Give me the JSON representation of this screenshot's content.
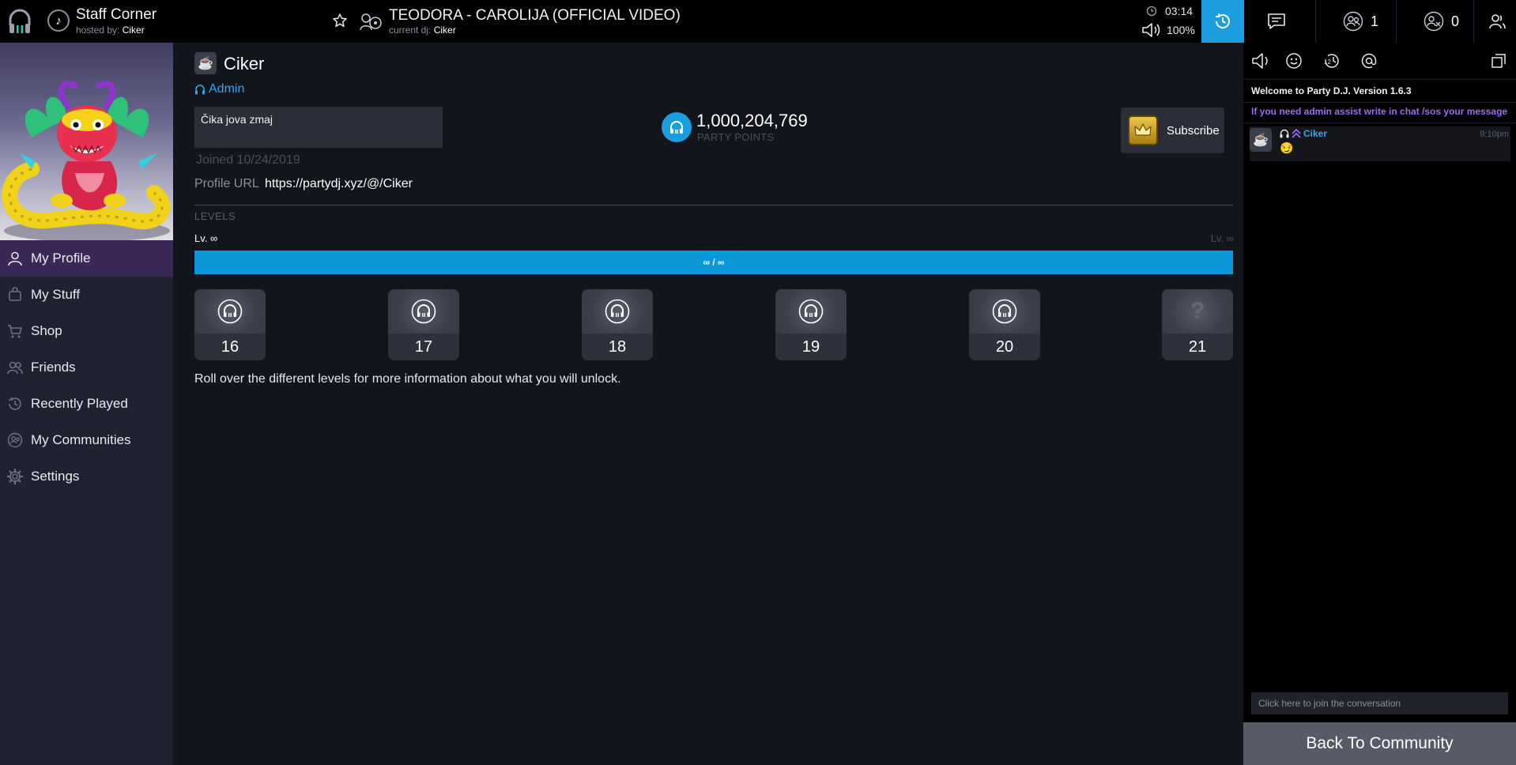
{
  "topbar": {
    "room_name": "Staff Corner",
    "hosted_label": "hosted by:",
    "host": "Ciker",
    "song_title": "TEODORA - CAROLIJA (OFFICIAL VIDEO)",
    "current_dj_label": "current dj:",
    "current_dj": "Ciker",
    "time": "03:14",
    "volume": "100%",
    "listeners_count": "1",
    "vip_count": "0",
    "icons": [
      "headphones-logo-icon",
      "music-note-icon",
      "star-icon",
      "dj-icon",
      "clock-icon",
      "volume-icon",
      "history-icon",
      "chat-icon",
      "users-icon",
      "vip-users-icon",
      "profile-icon"
    ]
  },
  "sidebar": {
    "items": [
      {
        "label": "My Profile",
        "icon": "user-icon"
      },
      {
        "label": "My Stuff",
        "icon": "bag-icon"
      },
      {
        "label": "Shop",
        "icon": "cart-icon"
      },
      {
        "label": "Friends",
        "icon": "friends-icon"
      },
      {
        "label": "Recently Played",
        "icon": "history-icon"
      },
      {
        "label": "My Communities",
        "icon": "community-icon"
      },
      {
        "label": "Settings",
        "icon": "gear-icon"
      }
    ]
  },
  "profile": {
    "name": "Ciker",
    "role": "Admin",
    "bio": "Čika jova zmaj",
    "joined": "Joined 10/24/2019",
    "profile_url_label": "Profile URL",
    "profile_url": "https://partydj.xyz/@/Ciker",
    "party_points": "1,000,204,769",
    "party_points_label": "PARTY POINTS",
    "subscribe_label": "Subscribe"
  },
  "levels": {
    "heading": "LEVELS",
    "current": "Lv. ∞",
    "next": "Lv. ∞",
    "progress_text": "∞ / ∞",
    "progress_fraction": 1.0,
    "tiles": [
      {
        "number": "16",
        "locked": false
      },
      {
        "number": "17",
        "locked": false
      },
      {
        "number": "18",
        "locked": false
      },
      {
        "number": "19",
        "locked": false
      },
      {
        "number": "20",
        "locked": false
      },
      {
        "number": "21",
        "locked": true,
        "symbol": "?"
      }
    ],
    "hint": "Roll over the different levels for more information about what you will unlock."
  },
  "chat": {
    "welcome": "Welcome to Party D.J. Version 1.6.3",
    "admin_notice": "If you need admin assist write in chat /sos your message",
    "messages": [
      {
        "user": "Ciker",
        "time": "9:10pm",
        "text": "😏"
      }
    ],
    "input_placeholder": "Click here to join the conversation",
    "back_button": "Back To Community"
  },
  "colors": {
    "accent": "#1a9ee0",
    "admin_notice": "#9a6bf5",
    "sidebar_active": "#3b2856",
    "level_bar": "#0b97d8"
  }
}
